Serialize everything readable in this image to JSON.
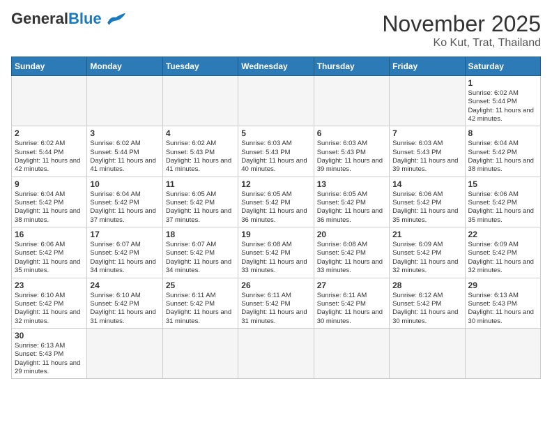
{
  "header": {
    "logo": {
      "general": "General",
      "blue": "Blue"
    },
    "title": "November 2025",
    "location": "Ko Kut, Trat, Thailand"
  },
  "calendar": {
    "days_of_week": [
      "Sunday",
      "Monday",
      "Tuesday",
      "Wednesday",
      "Thursday",
      "Friday",
      "Saturday"
    ],
    "weeks": [
      [
        {
          "day": "",
          "empty": true
        },
        {
          "day": "",
          "empty": true
        },
        {
          "day": "",
          "empty": true
        },
        {
          "day": "",
          "empty": true
        },
        {
          "day": "",
          "empty": true
        },
        {
          "day": "",
          "empty": true
        },
        {
          "day": "1",
          "sunrise": "6:02 AM",
          "sunset": "5:44 PM",
          "daylight": "11 hours and 42 minutes."
        }
      ],
      [
        {
          "day": "2",
          "sunrise": "6:02 AM",
          "sunset": "5:44 PM",
          "daylight": "11 hours and 42 minutes."
        },
        {
          "day": "3",
          "sunrise": "6:02 AM",
          "sunset": "5:44 PM",
          "daylight": "11 hours and 41 minutes."
        },
        {
          "day": "4",
          "sunrise": "6:02 AM",
          "sunset": "5:43 PM",
          "daylight": "11 hours and 41 minutes."
        },
        {
          "day": "5",
          "sunrise": "6:03 AM",
          "sunset": "5:43 PM",
          "daylight": "11 hours and 40 minutes."
        },
        {
          "day": "6",
          "sunrise": "6:03 AM",
          "sunset": "5:43 PM",
          "daylight": "11 hours and 39 minutes."
        },
        {
          "day": "7",
          "sunrise": "6:03 AM",
          "sunset": "5:43 PM",
          "daylight": "11 hours and 39 minutes."
        },
        {
          "day": "8",
          "sunrise": "6:04 AM",
          "sunset": "5:42 PM",
          "daylight": "11 hours and 38 minutes."
        }
      ],
      [
        {
          "day": "9",
          "sunrise": "6:04 AM",
          "sunset": "5:42 PM",
          "daylight": "11 hours and 38 minutes."
        },
        {
          "day": "10",
          "sunrise": "6:04 AM",
          "sunset": "5:42 PM",
          "daylight": "11 hours and 37 minutes."
        },
        {
          "day": "11",
          "sunrise": "6:05 AM",
          "sunset": "5:42 PM",
          "daylight": "11 hours and 37 minutes."
        },
        {
          "day": "12",
          "sunrise": "6:05 AM",
          "sunset": "5:42 PM",
          "daylight": "11 hours and 36 minutes."
        },
        {
          "day": "13",
          "sunrise": "6:05 AM",
          "sunset": "5:42 PM",
          "daylight": "11 hours and 36 minutes."
        },
        {
          "day": "14",
          "sunrise": "6:06 AM",
          "sunset": "5:42 PM",
          "daylight": "11 hours and 35 minutes."
        },
        {
          "day": "15",
          "sunrise": "6:06 AM",
          "sunset": "5:42 PM",
          "daylight": "11 hours and 35 minutes."
        }
      ],
      [
        {
          "day": "16",
          "sunrise": "6:06 AM",
          "sunset": "5:42 PM",
          "daylight": "11 hours and 35 minutes."
        },
        {
          "day": "17",
          "sunrise": "6:07 AM",
          "sunset": "5:42 PM",
          "daylight": "11 hours and 34 minutes."
        },
        {
          "day": "18",
          "sunrise": "6:07 AM",
          "sunset": "5:42 PM",
          "daylight": "11 hours and 34 minutes."
        },
        {
          "day": "19",
          "sunrise": "6:08 AM",
          "sunset": "5:42 PM",
          "daylight": "11 hours and 33 minutes."
        },
        {
          "day": "20",
          "sunrise": "6:08 AM",
          "sunset": "5:42 PM",
          "daylight": "11 hours and 33 minutes."
        },
        {
          "day": "21",
          "sunrise": "6:09 AM",
          "sunset": "5:42 PM",
          "daylight": "11 hours and 32 minutes."
        },
        {
          "day": "22",
          "sunrise": "6:09 AM",
          "sunset": "5:42 PM",
          "daylight": "11 hours and 32 minutes."
        }
      ],
      [
        {
          "day": "23",
          "sunrise": "6:10 AM",
          "sunset": "5:42 PM",
          "daylight": "11 hours and 32 minutes."
        },
        {
          "day": "24",
          "sunrise": "6:10 AM",
          "sunset": "5:42 PM",
          "daylight": "11 hours and 31 minutes."
        },
        {
          "day": "25",
          "sunrise": "6:11 AM",
          "sunset": "5:42 PM",
          "daylight": "11 hours and 31 minutes."
        },
        {
          "day": "26",
          "sunrise": "6:11 AM",
          "sunset": "5:42 PM",
          "daylight": "11 hours and 31 minutes."
        },
        {
          "day": "27",
          "sunrise": "6:11 AM",
          "sunset": "5:42 PM",
          "daylight": "11 hours and 30 minutes."
        },
        {
          "day": "28",
          "sunrise": "6:12 AM",
          "sunset": "5:42 PM",
          "daylight": "11 hours and 30 minutes."
        },
        {
          "day": "29",
          "sunrise": "6:13 AM",
          "sunset": "5:43 PM",
          "daylight": "11 hours and 30 minutes."
        }
      ],
      [
        {
          "day": "30",
          "sunrise": "6:13 AM",
          "sunset": "5:43 PM",
          "daylight": "11 hours and 29 minutes."
        },
        {
          "day": "",
          "empty": true
        },
        {
          "day": "",
          "empty": true
        },
        {
          "day": "",
          "empty": true
        },
        {
          "day": "",
          "empty": true
        },
        {
          "day": "",
          "empty": true
        },
        {
          "day": "",
          "empty": true
        }
      ]
    ]
  },
  "labels": {
    "sunrise_prefix": "Sunrise: ",
    "sunset_prefix": "Sunset: ",
    "daylight_prefix": "Daylight: "
  }
}
